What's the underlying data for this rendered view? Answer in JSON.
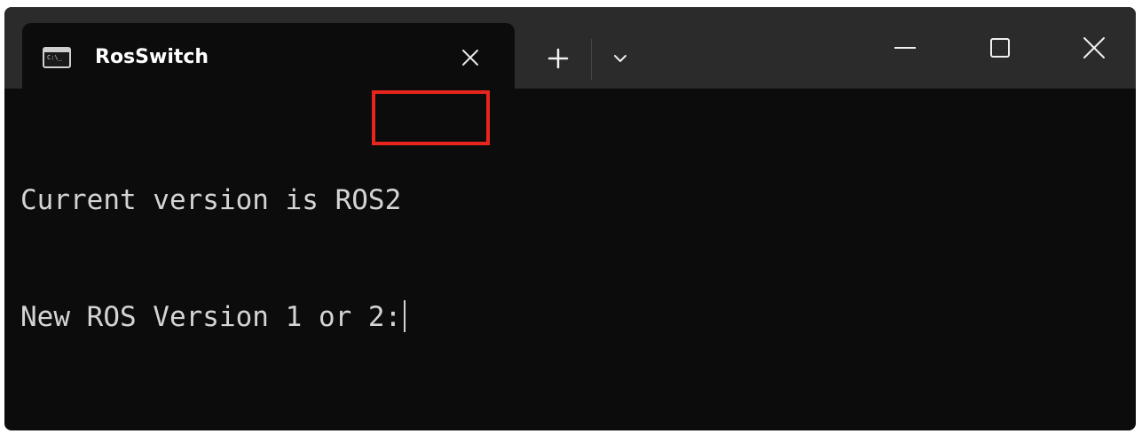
{
  "window": {
    "tab_title": "RosSwitch",
    "tab_icon": "terminal-icon",
    "title_icons": {
      "close_tab": "close-icon",
      "new_tab": "plus-icon",
      "dropdown": "chevron-down-icon",
      "minimize": "minimize-icon",
      "maximize": "maximize-icon",
      "close_window": "close-icon"
    }
  },
  "terminal": {
    "line1_prefix": "Current version is ",
    "line1_version": "ROS2",
    "line2_prompt": "New ROS Version 1 or 2:"
  },
  "colors": {
    "terminal_bg": "#0c0c0c",
    "titlebar_bg": "#2b2b2b",
    "text": "#d4d4d4",
    "highlight_border": "#e8251c"
  }
}
